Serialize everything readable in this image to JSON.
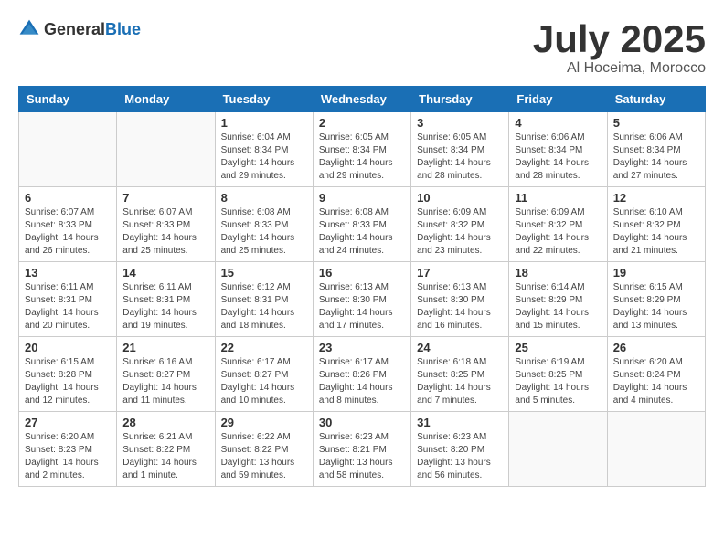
{
  "header": {
    "logo_general": "General",
    "logo_blue": "Blue",
    "month_title": "July 2025",
    "subtitle": "Al Hoceima, Morocco"
  },
  "weekdays": [
    "Sunday",
    "Monday",
    "Tuesday",
    "Wednesday",
    "Thursday",
    "Friday",
    "Saturday"
  ],
  "weeks": [
    [
      {
        "day": "",
        "detail": ""
      },
      {
        "day": "",
        "detail": ""
      },
      {
        "day": "1",
        "detail": "Sunrise: 6:04 AM\nSunset: 8:34 PM\nDaylight: 14 hours and 29 minutes."
      },
      {
        "day": "2",
        "detail": "Sunrise: 6:05 AM\nSunset: 8:34 PM\nDaylight: 14 hours and 29 minutes."
      },
      {
        "day": "3",
        "detail": "Sunrise: 6:05 AM\nSunset: 8:34 PM\nDaylight: 14 hours and 28 minutes."
      },
      {
        "day": "4",
        "detail": "Sunrise: 6:06 AM\nSunset: 8:34 PM\nDaylight: 14 hours and 28 minutes."
      },
      {
        "day": "5",
        "detail": "Sunrise: 6:06 AM\nSunset: 8:34 PM\nDaylight: 14 hours and 27 minutes."
      }
    ],
    [
      {
        "day": "6",
        "detail": "Sunrise: 6:07 AM\nSunset: 8:33 PM\nDaylight: 14 hours and 26 minutes."
      },
      {
        "day": "7",
        "detail": "Sunrise: 6:07 AM\nSunset: 8:33 PM\nDaylight: 14 hours and 25 minutes."
      },
      {
        "day": "8",
        "detail": "Sunrise: 6:08 AM\nSunset: 8:33 PM\nDaylight: 14 hours and 25 minutes."
      },
      {
        "day": "9",
        "detail": "Sunrise: 6:08 AM\nSunset: 8:33 PM\nDaylight: 14 hours and 24 minutes."
      },
      {
        "day": "10",
        "detail": "Sunrise: 6:09 AM\nSunset: 8:32 PM\nDaylight: 14 hours and 23 minutes."
      },
      {
        "day": "11",
        "detail": "Sunrise: 6:09 AM\nSunset: 8:32 PM\nDaylight: 14 hours and 22 minutes."
      },
      {
        "day": "12",
        "detail": "Sunrise: 6:10 AM\nSunset: 8:32 PM\nDaylight: 14 hours and 21 minutes."
      }
    ],
    [
      {
        "day": "13",
        "detail": "Sunrise: 6:11 AM\nSunset: 8:31 PM\nDaylight: 14 hours and 20 minutes."
      },
      {
        "day": "14",
        "detail": "Sunrise: 6:11 AM\nSunset: 8:31 PM\nDaylight: 14 hours and 19 minutes."
      },
      {
        "day": "15",
        "detail": "Sunrise: 6:12 AM\nSunset: 8:31 PM\nDaylight: 14 hours and 18 minutes."
      },
      {
        "day": "16",
        "detail": "Sunrise: 6:13 AM\nSunset: 8:30 PM\nDaylight: 14 hours and 17 minutes."
      },
      {
        "day": "17",
        "detail": "Sunrise: 6:13 AM\nSunset: 8:30 PM\nDaylight: 14 hours and 16 minutes."
      },
      {
        "day": "18",
        "detail": "Sunrise: 6:14 AM\nSunset: 8:29 PM\nDaylight: 14 hours and 15 minutes."
      },
      {
        "day": "19",
        "detail": "Sunrise: 6:15 AM\nSunset: 8:29 PM\nDaylight: 14 hours and 13 minutes."
      }
    ],
    [
      {
        "day": "20",
        "detail": "Sunrise: 6:15 AM\nSunset: 8:28 PM\nDaylight: 14 hours and 12 minutes."
      },
      {
        "day": "21",
        "detail": "Sunrise: 6:16 AM\nSunset: 8:27 PM\nDaylight: 14 hours and 11 minutes."
      },
      {
        "day": "22",
        "detail": "Sunrise: 6:17 AM\nSunset: 8:27 PM\nDaylight: 14 hours and 10 minutes."
      },
      {
        "day": "23",
        "detail": "Sunrise: 6:17 AM\nSunset: 8:26 PM\nDaylight: 14 hours and 8 minutes."
      },
      {
        "day": "24",
        "detail": "Sunrise: 6:18 AM\nSunset: 8:25 PM\nDaylight: 14 hours and 7 minutes."
      },
      {
        "day": "25",
        "detail": "Sunrise: 6:19 AM\nSunset: 8:25 PM\nDaylight: 14 hours and 5 minutes."
      },
      {
        "day": "26",
        "detail": "Sunrise: 6:20 AM\nSunset: 8:24 PM\nDaylight: 14 hours and 4 minutes."
      }
    ],
    [
      {
        "day": "27",
        "detail": "Sunrise: 6:20 AM\nSunset: 8:23 PM\nDaylight: 14 hours and 2 minutes."
      },
      {
        "day": "28",
        "detail": "Sunrise: 6:21 AM\nSunset: 8:22 PM\nDaylight: 14 hours and 1 minute."
      },
      {
        "day": "29",
        "detail": "Sunrise: 6:22 AM\nSunset: 8:22 PM\nDaylight: 13 hours and 59 minutes."
      },
      {
        "day": "30",
        "detail": "Sunrise: 6:23 AM\nSunset: 8:21 PM\nDaylight: 13 hours and 58 minutes."
      },
      {
        "day": "31",
        "detail": "Sunrise: 6:23 AM\nSunset: 8:20 PM\nDaylight: 13 hours and 56 minutes."
      },
      {
        "day": "",
        "detail": ""
      },
      {
        "day": "",
        "detail": ""
      }
    ]
  ]
}
